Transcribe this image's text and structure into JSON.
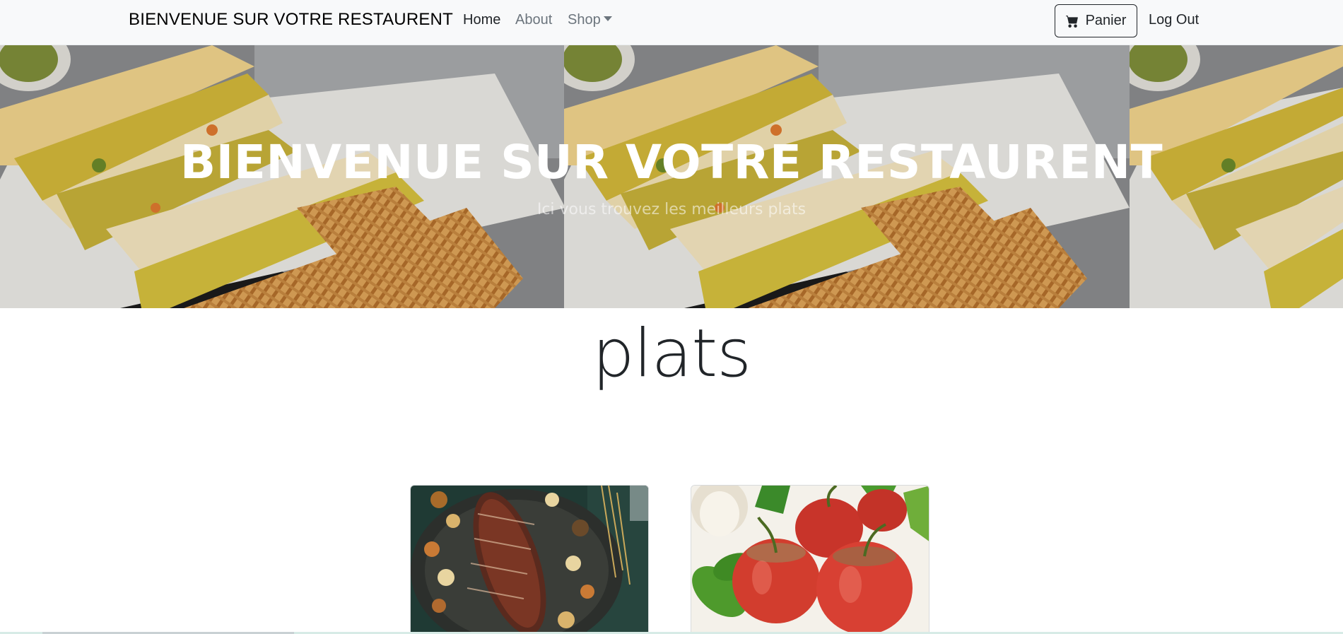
{
  "navbar": {
    "brand": "BIENVENUE SUR VOTRE RESTAURENT",
    "links": [
      {
        "label": "Home",
        "active": true
      },
      {
        "label": "About",
        "active": false
      },
      {
        "label": "Shop",
        "active": false,
        "dropdown": true
      }
    ],
    "cart_label": "Panier",
    "cart_icon": "cart-icon",
    "logout_label": "Log Out"
  },
  "hero": {
    "title": "BIENVENUE SUR VOTRE RESTAURENT",
    "subtitle": "Ici vous trouvez les meilleurs plats"
  },
  "section": {
    "title": "plats"
  },
  "cards": [
    {
      "image": "roast-meat-with-vegetables"
    },
    {
      "image": "stuffed-tomatoes"
    }
  ],
  "colors": {
    "navbar_bg": "#f8f9fa",
    "text_dark": "#212529",
    "text_muted": "#6c757d"
  }
}
